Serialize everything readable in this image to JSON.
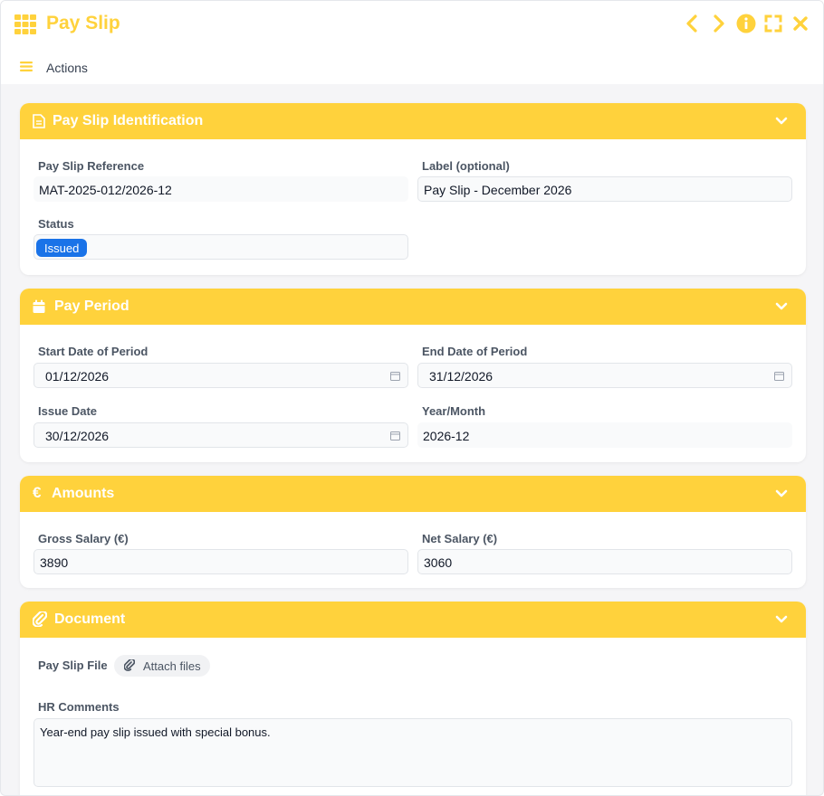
{
  "window": {
    "title": "Pay Slip",
    "accent_color": "#ffd23c",
    "controls": [
      "chevron-left-icon",
      "chevron-right-icon",
      "info-icon",
      "fullscreen-icon",
      "close-icon"
    ]
  },
  "toolbar": {
    "actions_label": "Actions"
  },
  "sections": {
    "identification": {
      "title": "Pay Slip Identification",
      "reference_label": "Pay Slip Reference",
      "reference_value": "MAT-2025-012/2026-12",
      "label_label": "Label (optional)",
      "label_value": "Pay Slip - December 2026",
      "status_label": "Status",
      "status_value": "Issued",
      "status_color": "#1a73e8"
    },
    "period": {
      "title": "Pay Period",
      "start_label": "Start Date of Period",
      "start_value": "01/12/2026",
      "end_label": "End Date of Period",
      "end_value": "31/12/2026",
      "issue_label": "Issue Date",
      "issue_value": "30/12/2026",
      "yearmonth_label": "Year/Month",
      "yearmonth_value": "2026-12"
    },
    "amounts": {
      "title": "Amounts",
      "gross_label": "Gross Salary (€)",
      "gross_value": "3890",
      "net_label": "Net Salary (€)",
      "net_value": "3060"
    },
    "document": {
      "title": "Document",
      "file_label": "Pay Slip File",
      "attach_label": "Attach files",
      "comments_label": "HR Comments",
      "comments_value": "Year-end pay slip issued with special bonus."
    }
  }
}
